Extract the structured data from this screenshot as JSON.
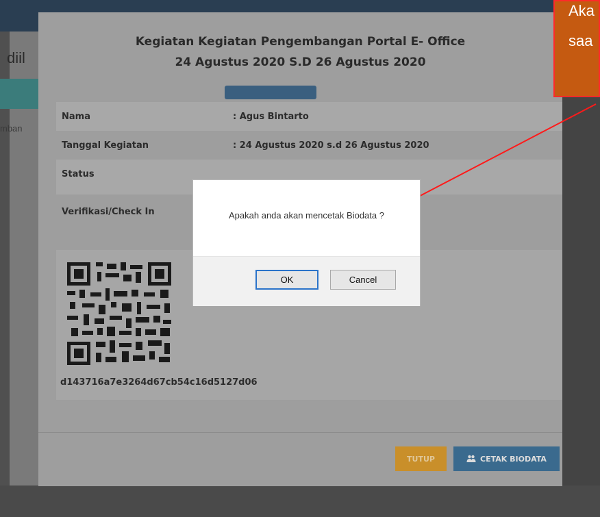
{
  "background_page": {
    "left_text": "diil",
    "left_small_text": "mban"
  },
  "modal": {
    "title_line1": "Kegiatan Kegiatan Pengembangan Portal E- Office",
    "title_line2": "24 Agustus 2020 S.D 26 Agustus 2020",
    "rows": [
      {
        "label": "Nama",
        "value": ": Agus Bintarto"
      },
      {
        "label": "Tanggal Kegiatan",
        "value": ": 24 Agustus 2020 s.d 26 Agustus 2020"
      },
      {
        "label": "Status",
        "value": ""
      },
      {
        "label": "Verifikasi/Check In",
        "value": ""
      }
    ],
    "hash": "d143716a7e3264d67cb54c16d5127d06",
    "buttons": {
      "tutup": "TUTUP",
      "cetak": "CETAK BIODATA"
    },
    "icons": {
      "cetak": "users-icon"
    }
  },
  "confirm_dialog": {
    "message": "Apakah anda akan mencetak Biodata ?",
    "ok_label": "OK",
    "cancel_label": "Cancel"
  },
  "annotation": {
    "text_line1": "Aka",
    "text_line2": "saa"
  },
  "colors": {
    "annotation_fill": "#c55a11",
    "annotation_border": "#ff2a2a",
    "tutup_button": "#c98f2a",
    "cetak_button": "#3a6a8e"
  }
}
